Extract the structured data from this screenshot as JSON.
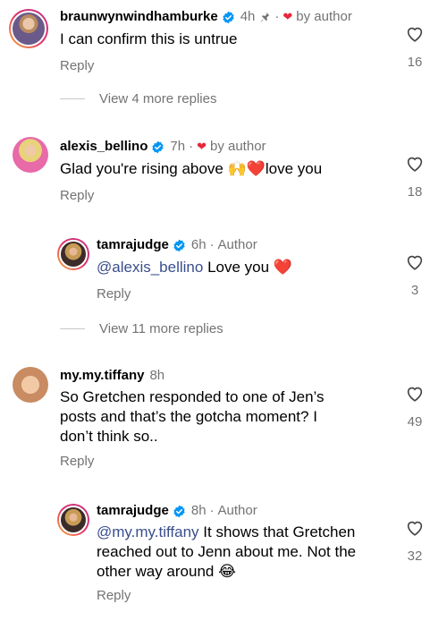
{
  "comments": [
    {
      "user": "braunwynwindhamburke",
      "time": "4h",
      "by_author": "by author",
      "text": "I can confirm this is untrue",
      "reply": "Reply",
      "likes": "16"
    },
    {
      "user": "alexis_bellino",
      "time": "7h",
      "by_author": "by author",
      "text": "Glad you're rising above",
      "emoji1": "🙌",
      "emoji2": "❤️",
      "text2": "love you",
      "reply": "Reply",
      "likes": "18"
    },
    {
      "user": "tamrajudge",
      "time": "6h",
      "author": "Author",
      "mention": "@alexis_bellino",
      "text": "Love you",
      "emoji": "❤️",
      "reply": "Reply",
      "likes": "3"
    },
    {
      "user": "my.my.tiffany",
      "time": "8h",
      "text_line1": "So Gretchen responded to one of Jen’s",
      "text_line2": "posts and that’s the gotcha moment? I",
      "text_line3": "don’t think so..",
      "reply": "Reply",
      "likes": "49"
    },
    {
      "user": "tamrajudge",
      "time": "8h",
      "author": "Author",
      "mention": "@my.my.tiffany",
      "text_line1": "It shows that Gretchen",
      "text_line2": "reached out to Jenn about me. Not the",
      "text_line3": "other way around",
      "emoji": "😂",
      "reply": "Reply",
      "likes": "32"
    }
  ],
  "view_more": [
    "View 4 more replies",
    "View 11 more replies"
  ],
  "colors": {
    "verified": "#0095f6",
    "like_heart_author": "#e8253b",
    "meta": "#737373",
    "mention": "#3a4e8c"
  }
}
